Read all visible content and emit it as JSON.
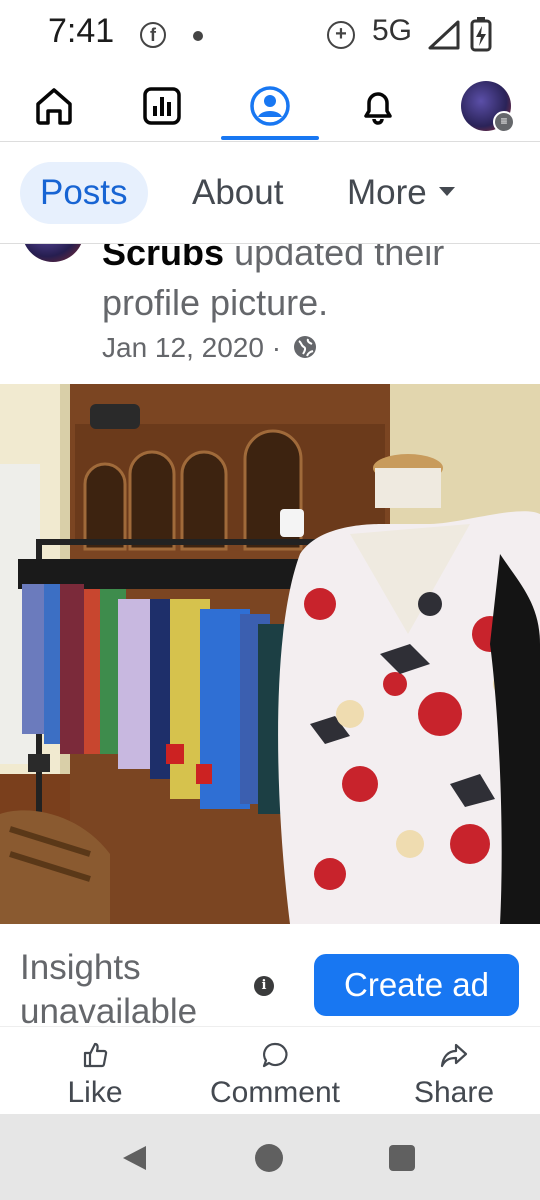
{
  "status_bar": {
    "time": "7:41",
    "network": "5G",
    "fb_glyph": "f",
    "data_saver_glyph": "+"
  },
  "top_nav": {
    "items": [
      "home-icon",
      "stats-icon",
      "profile-icon",
      "bell-icon",
      "account-avatar"
    ],
    "active": "profile-icon"
  },
  "tabs": {
    "posts": "Posts",
    "about": "About",
    "more": "More"
  },
  "post": {
    "author": "Scrubs",
    "action_text": "updated their",
    "action_text_2": "profile picture.",
    "date": "Jan 12, 2020 ·"
  },
  "insights": {
    "text": "Insights unavailable",
    "info_glyph": "i",
    "create_ad": "Create ad"
  },
  "actions": {
    "like": "Like",
    "comment": "Comment",
    "share": "Share"
  },
  "colors": {
    "accent": "#1877f2",
    "active_tab_bg": "#e7f0fd",
    "secondary_text": "#65676b",
    "nav_bar_bg": "#e6e6e6"
  }
}
